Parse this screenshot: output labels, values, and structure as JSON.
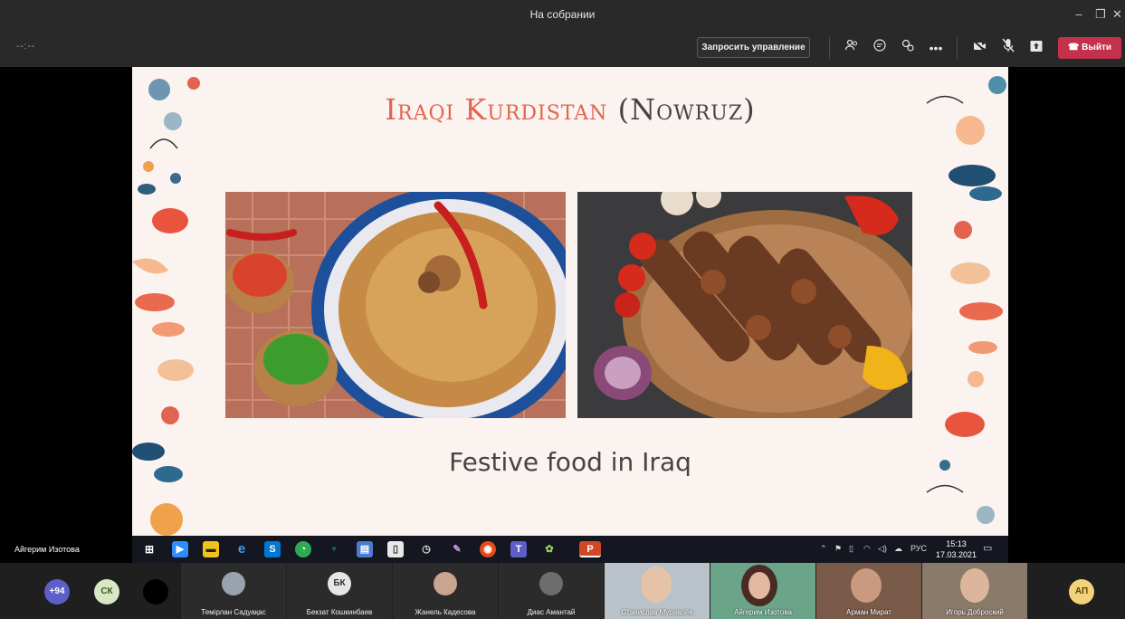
{
  "window": {
    "title": "На собрании"
  },
  "toolbar": {
    "timer": "--:--",
    "request_control": "Запросить управление",
    "leave": "Выйти"
  },
  "slide": {
    "title_part1": "Iraqi Kurdistan",
    "title_part2": "(Nowruz)",
    "caption": "Festive food in Iraq"
  },
  "presenter": "Айгерим Изотова",
  "taskbar": {
    "pp_label": "P",
    "language": "РУС",
    "time": "15:13",
    "date": "17.03.2021"
  },
  "participants": {
    "overflow_count": "+94",
    "avatar_initials_1": "СК",
    "tiles": [
      {
        "name": "Темірлан Садуақас"
      },
      {
        "name": "Бекзат Кошкинбаев",
        "initials": "БК"
      },
      {
        "name": "Жанель Кадесова"
      },
      {
        "name": "Диас Амантай"
      }
    ],
    "videos": [
      {
        "name": "Станислав Муравлёв"
      },
      {
        "name": "Айгерим Изотова"
      },
      {
        "name": "Арман Мират"
      },
      {
        "name": "Игорь Доброский"
      }
    ],
    "last_avatar": "АП"
  },
  "colors": {
    "leave": "#c4314b",
    "title_accent": "#e2644f",
    "teams_purple": "#5b5fc7"
  }
}
